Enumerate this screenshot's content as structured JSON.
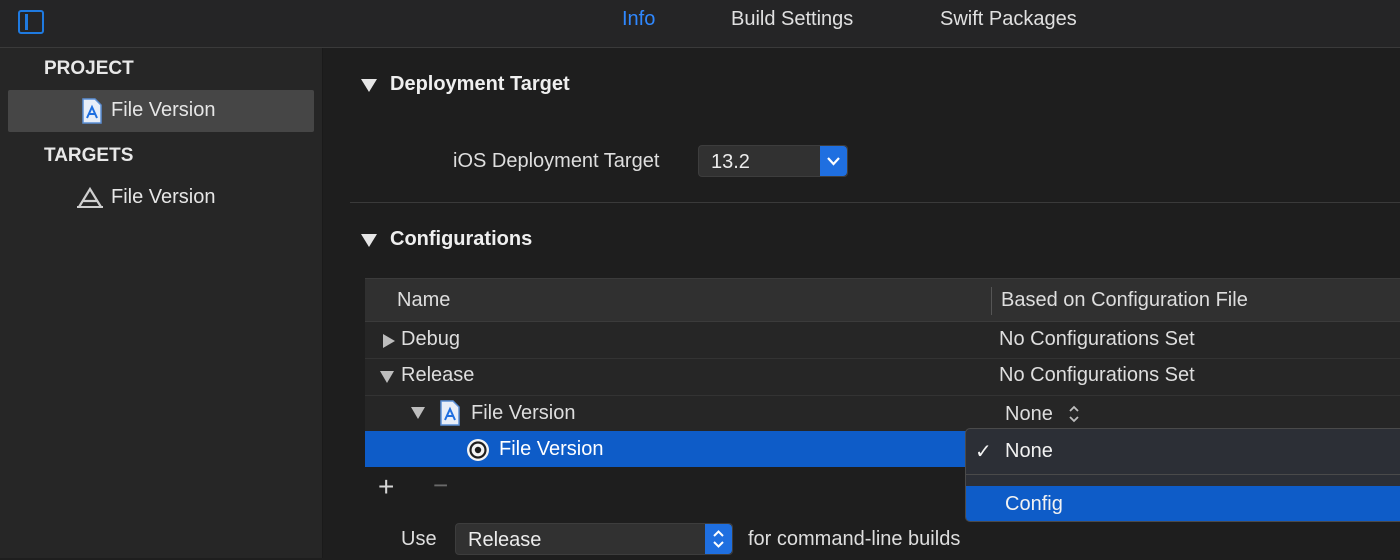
{
  "toolbar": {
    "tabs": [
      {
        "label": "Info",
        "active": true
      },
      {
        "label": "Build Settings",
        "active": false
      },
      {
        "label": "Swift Packages",
        "active": false
      }
    ],
    "accent_color": "#2f88ff"
  },
  "sidebar": {
    "project_header": "PROJECT",
    "project_item": {
      "label": "File Version",
      "icon": "project-file-icon",
      "selected": true
    },
    "targets_header": "TARGETS",
    "target_item": {
      "label": "File Version",
      "icon": "app-target-icon",
      "selected": false
    }
  },
  "deployment": {
    "title": "Deployment Target",
    "label": "iOS Deployment Target",
    "value": "13.2"
  },
  "configurations": {
    "title": "Configurations",
    "columns": [
      "Name",
      "Based on Configuration File"
    ],
    "rows": [
      {
        "name": "Debug",
        "config": "No Configurations Set",
        "expanded": false
      },
      {
        "name": "Release",
        "config": "No Configurations Set",
        "expanded": true
      },
      {
        "name": "File Version",
        "config": "None",
        "icon": "project-file-icon"
      },
      {
        "name": "File Version",
        "config": "",
        "icon": "target-icon",
        "selected": true
      }
    ],
    "add_symbol": "+",
    "remove_symbol": "−"
  },
  "dropdown": {
    "items": [
      {
        "label": "None",
        "checked": true,
        "highlighted": false
      },
      {
        "label": "Config",
        "checked": false,
        "highlighted": true
      }
    ],
    "check_glyph": "✓"
  },
  "footer": {
    "use_label": "Use",
    "selected": "Release",
    "suffix": "for command-line builds"
  }
}
